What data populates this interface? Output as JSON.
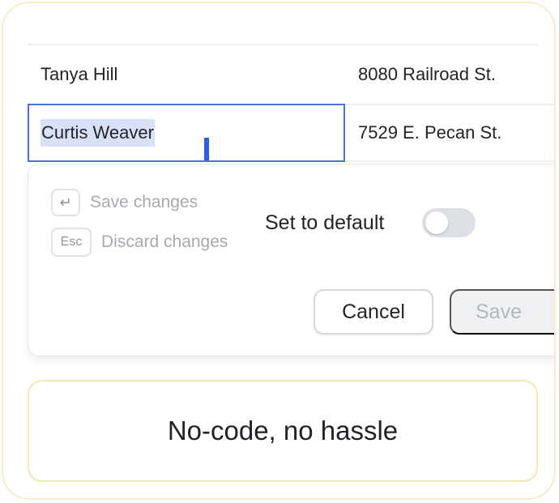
{
  "table": {
    "rows": [
      {
        "name": "Tanya Hill",
        "address": "8080 Railroad St."
      },
      {
        "name": "Curtis Weaver",
        "address": "7529 E. Pecan St."
      }
    ]
  },
  "popover": {
    "save_hint": "Save changes",
    "enter_key": "↵",
    "discard_hint": "Discard changes",
    "esc_key": "Esc",
    "default_label": "Set to default",
    "toggle_on": false,
    "cancel_label": "Cancel",
    "save_label": "Save"
  },
  "banner": {
    "text": "No-code, no hassle"
  },
  "colors": {
    "card_border": "#fbecc4",
    "selection": "#d9e1f8",
    "edit_border": "#4a72de",
    "caret": "#2b5fe3"
  }
}
